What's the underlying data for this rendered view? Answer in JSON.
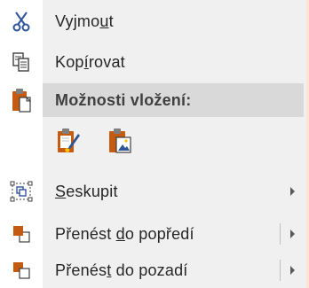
{
  "menu": {
    "cut": {
      "pre": "Vyjmo",
      "acc": "u",
      "post": "t"
    },
    "copy": {
      "pre": "Kop",
      "acc": "í",
      "post": "rovat"
    },
    "paste_options": "Možnosti vložení:",
    "group": {
      "pre": "",
      "acc": "S",
      "post": "eskupit"
    },
    "bring_forward": {
      "pre": "Přenést ",
      "acc": "d",
      "post": "o popředí"
    },
    "send_backward": {
      "pre": "Přenés",
      "acc": "t",
      "post": " do pozadí"
    }
  },
  "colors": {
    "background_border": "#fbe5d6",
    "menu_bg": "#f0f0f0",
    "header_bg": "#d9d9d9",
    "icon_blue": "#2f5597",
    "icon_orange": "#c55a11",
    "icon_yellow": "#ffc000"
  },
  "icons": [
    "scissors-icon",
    "copy-icon",
    "clipboard-icon",
    "paste-keep-formatting-icon",
    "paste-picture-icon",
    "group-icon",
    "bring-forward-icon",
    "send-backward-icon"
  ]
}
